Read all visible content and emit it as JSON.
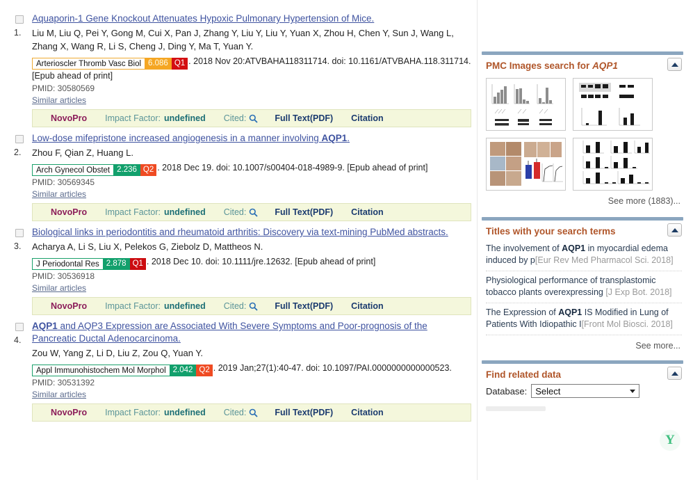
{
  "results": [
    {
      "number": "1.",
      "title": "Aquaporin-1 Gene Knockout Attenuates Hypoxic Pulmonary Hypertension of Mice.",
      "authors": "Liu M, Liu Q, Pei Y, Gong M, Cui X, Pan J, Zhang Y, Liu Y, Liu Y, Yuan X, Zhou H, Chen Y, Sun J, Wang L, Zhang X, Wang R, Li S, Cheng J, Ding Y, Ma T, Yuan Y.",
      "journal": "Arterioscler Thromb Vasc Biol",
      "impact_factor": "6.086",
      "quartile": "Q1",
      "badge_style": "b-orange",
      "quartile_class": "q1",
      "citation": ". 2018 Nov 20:ATVBAHA118311714. doi: 10.1161/ATVBAHA.118.311714.",
      "epub": "[Epub ahead of print]",
      "pmid": "PMID: 30580569",
      "similar": "Similar articles"
    },
    {
      "number": "2.",
      "title": "Low-dose mifepristone increased angiogenesis in a manner involving AQP1.",
      "title_bold": "AQP1",
      "authors": "Zhou F, Qian Z, Huang L.",
      "journal": "Arch Gynecol Obstet",
      "impact_factor": "2.236",
      "quartile": "Q2",
      "badge_style": "b-green",
      "quartile_class": "q2",
      "citation": ". 2018 Dec 19. doi: 10.1007/s00404-018-4989-9. [Epub ahead of print]",
      "epub": "",
      "pmid": "PMID: 30569345",
      "similar": "Similar articles"
    },
    {
      "number": "3.",
      "title": "Biological links in periodontitis and rheumatoid arthritis: Discovery via text-mining PubMed abstracts.",
      "authors": "Acharya A, Li S, Liu X, Pelekos G, Ziebolz D, Mattheos N.",
      "journal": "J Periodontal Res",
      "impact_factor": "2.878",
      "quartile": "Q1",
      "badge_style": "b-green",
      "quartile_class": "q1",
      "citation": ". 2018 Dec 10. doi: 10.1111/jre.12632. [Epub ahead of print]",
      "epub": "",
      "pmid": "PMID: 30536918",
      "similar": "Similar articles"
    },
    {
      "number": "4.",
      "title": "AQP1 and AQP3 Expression are Associated With Severe Symptoms and Poor-prognosis of the Pancreatic Ductal Adenocarcinoma.",
      "title_bold": "AQP1",
      "authors": "Zou W, Yang Z, Li D, Liu Z, Zou Q, Yuan Y.",
      "journal": "Appl Immunohistochem Mol Morphol",
      "impact_factor": "2.042",
      "quartile": "Q2",
      "badge_style": "b-green",
      "quartile_class": "q2",
      "citation": ". 2019 Jan;27(1):40-47. doi: 10.1097/PAI.0000000000000523.",
      "epub": "",
      "pmid": "PMID: 30531392",
      "similar": "Similar articles"
    }
  ],
  "novobar": {
    "brand": "NovoPro",
    "impact_factor_label": "Impact Factor:",
    "impact_factor_value": "undefined",
    "cited_label": "Cited:",
    "search_icon": "magnifier-icon",
    "full_text": "Full Text(PDF)",
    "citation": "Citation"
  },
  "sidebar": {
    "pmc_images": {
      "title_prefix": "PMC Images search for ",
      "query": "AQP1",
      "see_more": "See more (1883)..."
    },
    "titles_panel": {
      "title": "Titles with your search terms",
      "items": [
        {
          "text_before": "The involvement of ",
          "bold": "AQP1",
          "text_after": " in myocardial edema induced by p",
          "source": "[Eur Rev Med Pharmacol Sci. 2018]"
        },
        {
          "text_before": "Physiological performance of transplastomic tobacco plants overexpressing ",
          "bold": "",
          "text_after": "",
          "source": "[J Exp Bot. 2018]"
        },
        {
          "text_before": "The Expression of ",
          "bold": "AQP1",
          "text_after": " IS Modified in Lung of Patients With Idiopathic I",
          "source": "[Front Mol Biosci. 2018]"
        }
      ],
      "see_more": "See more..."
    },
    "related_data": {
      "title": "Find related data",
      "database_label": "Database:",
      "database_value": "Select"
    },
    "youdao_logo": "Y"
  },
  "colors": {
    "link": "#3f53a0",
    "panel_title": "#b0562a",
    "novobar_bg": "#f4f7dc",
    "q1_red": "#cc0c10",
    "q2_orange": "#ef4b23",
    "green": "#12a06c",
    "orange": "#f5a623"
  }
}
